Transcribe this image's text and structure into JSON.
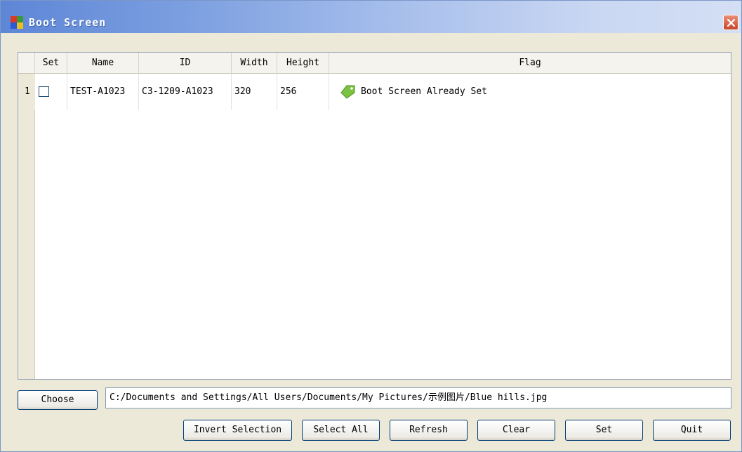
{
  "window": {
    "title": "Boot Screen",
    "icons": {
      "app": "app-icon",
      "close": "close-icon"
    }
  },
  "table": {
    "columns": [
      "Set",
      "Name",
      "ID",
      "Width",
      "Height",
      "Flag"
    ],
    "rows": [
      {
        "index": "1",
        "set_checked": false,
        "name": "TEST-A1023",
        "id": "C3-1209-A1023",
        "width": "320",
        "height": "256",
        "flag_icon": "tag-icon",
        "flag": "Boot Screen Already Set"
      }
    ]
  },
  "file": {
    "choose_label": "Choose",
    "path": "C:/Documents and Settings/All Users/Documents/My Pictures/示例图片/Blue hills.jpg"
  },
  "buttons": {
    "invert_selection": "Invert Selection",
    "select_all": "Select All",
    "refresh": "Refresh",
    "clear": "Clear",
    "set": "Set",
    "quit": "Quit"
  },
  "colors": {
    "title_gradient_start": "#5d86d6",
    "title_gradient_end": "#d4dff4",
    "window_bg": "#ece9d8",
    "close_button": "#c8462a",
    "tag_icon": "#7cc242"
  }
}
